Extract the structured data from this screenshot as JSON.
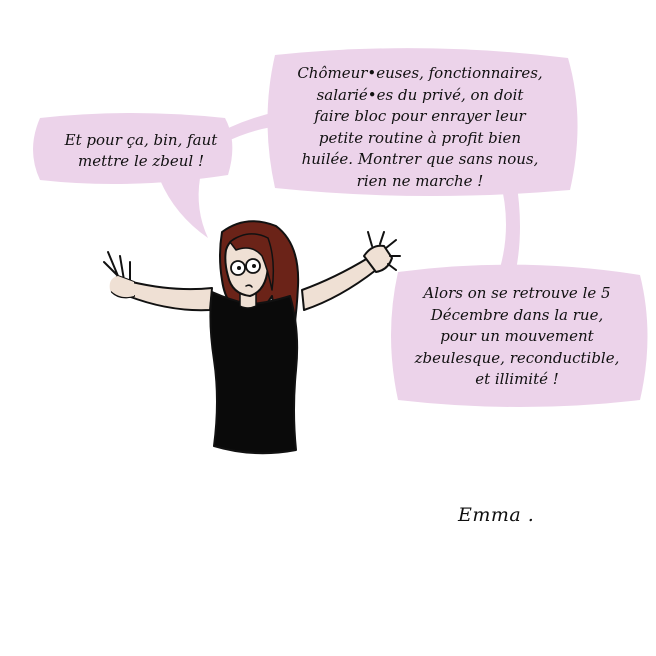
{
  "comic": {
    "bubble_left": {
      "lines": [
        "Et pour ça, bin, faut",
        "mettre le zbeul !"
      ]
    },
    "bubble_top": {
      "lines": [
        "Chômeur•euses, fonctionnaires,",
        "salarié•es du privé, on doit",
        "faire bloc pour enrayer leur",
        "petite routine à profit bien",
        "huilée. Montrer que sans nous,",
        "rien ne marche !"
      ]
    },
    "bubble_right": {
      "lines": [
        "Alors on se retrouve le 5",
        "Décembre dans la rue,",
        "pour un mouvement",
        "zbeulesque, reconductible,",
        "et illimité !"
      ]
    },
    "signature": "Emma ."
  },
  "colors": {
    "bubble_fill": "#ecd3ea",
    "outline": "#111111",
    "hair": "#6b2318",
    "skin": "#efe0d4",
    "shirt": "#0a0a0a",
    "background": "#ffffff"
  }
}
